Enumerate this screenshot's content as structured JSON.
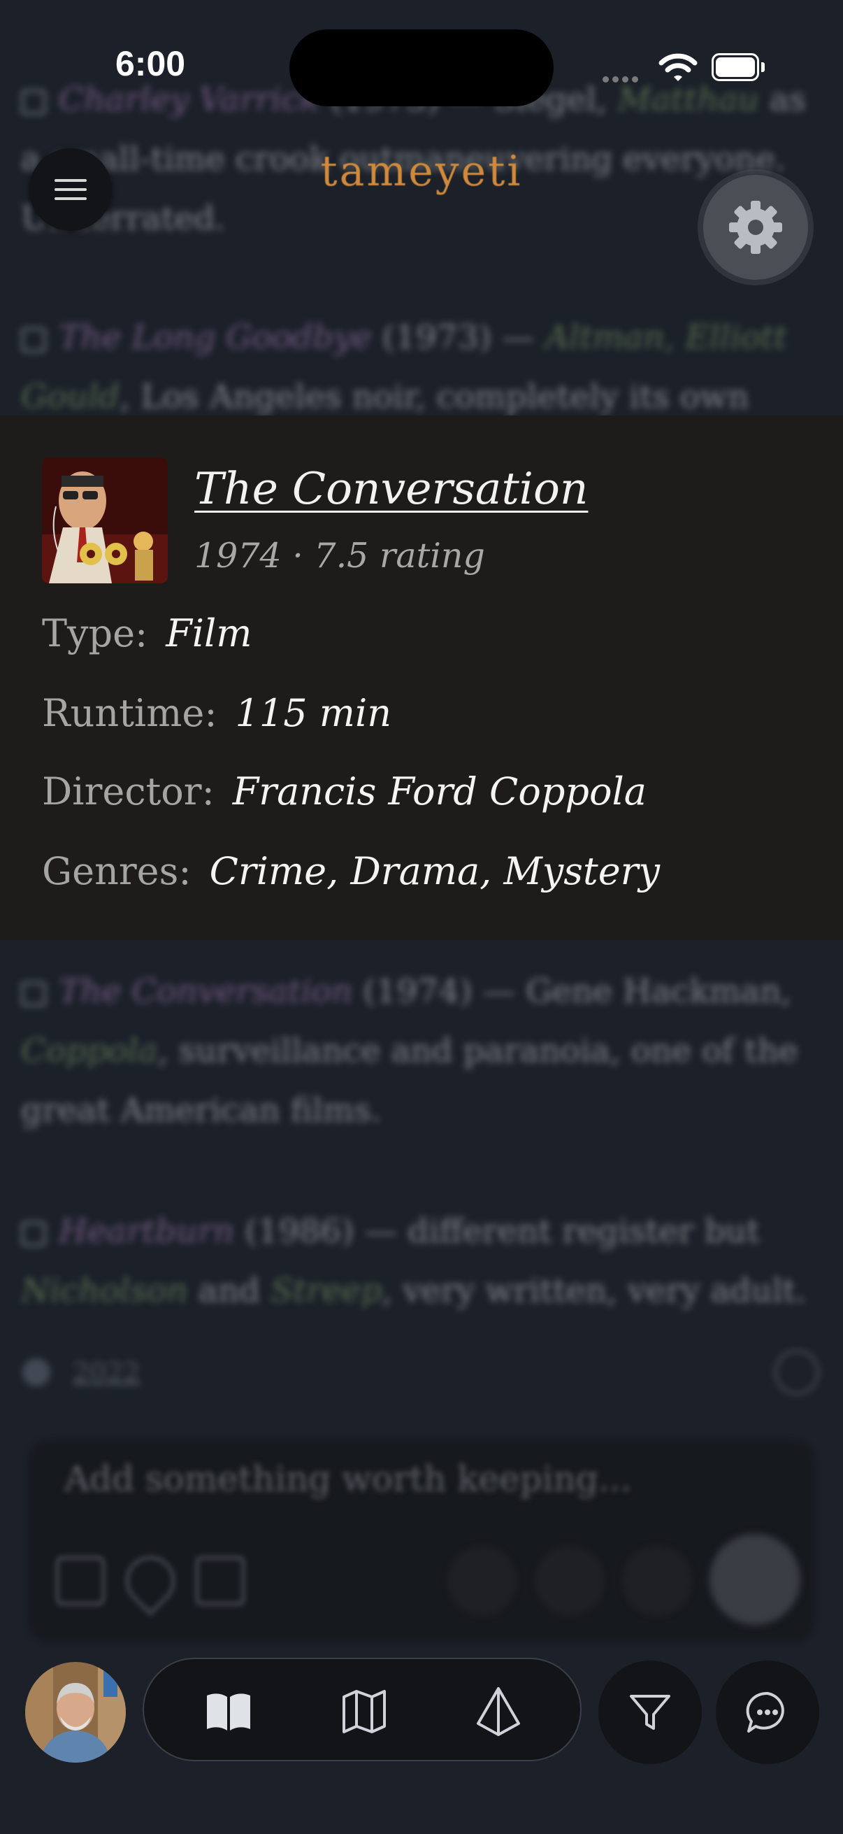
{
  "status_bar": {
    "time": "6:00"
  },
  "header": {
    "brand": "tameyeti"
  },
  "background_feed": [
    {
      "film": "Charley Varrick",
      "rest": " (1973) — Siegel, ",
      "person": "Matthau",
      "tail": " as a small-time crook outmaneuvering everyone. Underrated."
    },
    {
      "film": "The Long Goodbye",
      "rest": " (1973) — ",
      "person": "Altman, Elliott Gould",
      "tail": ", Los Angeles noir, completely its own thing. A man out of time."
    },
    {
      "film": "The Conversation",
      "rest": " (1974) — Gene Hackman, ",
      "person": "Coppola",
      "tail": ", surveillance and paranoia, one of the great American films."
    },
    {
      "film": "Heartburn",
      "rest": " (1986) — different register but ",
      "person": "Nicholson",
      "tail": " and ",
      "person2": "Streep",
      "tail2": ", very written, very adult."
    }
  ],
  "background_meta": "2022",
  "detail": {
    "title": "The Conversation",
    "subtitle": "1974 · 7.5 rating",
    "rows": [
      {
        "label": "Type:",
        "value": "Film"
      },
      {
        "label": "Runtime:",
        "value": "115 min"
      },
      {
        "label": "Director:",
        "value": "Francis Ford Coppola"
      },
      {
        "label": "Genres:",
        "value": "Crime, Drama, Mystery"
      }
    ]
  },
  "composer": {
    "placeholder": "Add something worth keeping..."
  },
  "nav": {
    "tabs": [
      "book-icon",
      "map-icon",
      "prism-icon"
    ],
    "filter": "filter-icon",
    "chat": "chat-icon"
  },
  "colors": {
    "brand": "#d18a3b",
    "film_link": "#b887c5",
    "person_link": "#87a86d",
    "card_bg": "#1d1c1b",
    "page_bg": "#1b2029"
  }
}
